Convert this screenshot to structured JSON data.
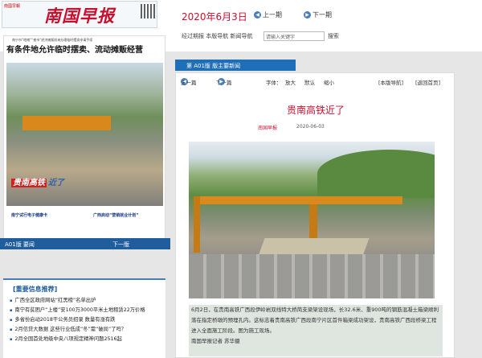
{
  "header": {
    "logo_small": "南國早報",
    "logo_main": "南国早报",
    "date": "2020年6月3日",
    "prev_issue": "上一期",
    "next_issue": "下一期",
    "nav_links": [
      "经过期报",
      "本版导航",
      "新闻导航"
    ],
    "search_placeholder": "请输入关键字",
    "search_button": "搜索"
  },
  "paper": {
    "subtitle": "南宁市“地摊”“夜市”经济摊贩前来办理临时摆卖申请手续",
    "headline": "有条件地允许临时摆卖、流动摊贩经营",
    "image_caption_a": "贵南高铁",
    "image_caption_b": "近了",
    "lower_a": "南宁试行电子健康卡",
    "lower_b": "广西启动“营销就业计划”",
    "page_label": "A01版 要闻",
    "next_page": "下一版"
  },
  "news": {
    "title": "[重要信息推荐]",
    "items": [
      "广西全区政府网站“红黑榜”名单出炉",
      "南宁有贫困户“上楼”安100万3000平米土地租赁22万价格",
      "多省份启动2018干公务员招录 数量有涨有跌",
      "2月信贷大数据 这些行业低成“冬”需“破局”了吗？",
      "2月全国首处地级中央八项规定精神问题2516起"
    ]
  },
  "article": {
    "version_bar": "第 A01版 版主要新闻",
    "prev": "上一篇",
    "next": "下一篇",
    "font_label": "字体：",
    "font_big": "放大",
    "font_default": "默认",
    "font_small": "缩小",
    "page_nav": "[本版导航]",
    "back_home": "[返回首页]",
    "title": "贵南高铁近了",
    "source": "南国早报",
    "date": "2020-06-03",
    "caption": "6月2日，在贵南高铁广西段伊岭岩双线特大桥简支梁架设现场，长32.6米、重900吨的钢筋混凝土箱梁顺利落在指定桥墩的预埋孔内。这标志着贵南高铁广西段南宁片区首件箱梁成功架设，贵南高铁广西段桥梁工程进入全面施工阶段。图为施工现场。",
    "reporter": "南国早报记者 苏华摄"
  }
}
